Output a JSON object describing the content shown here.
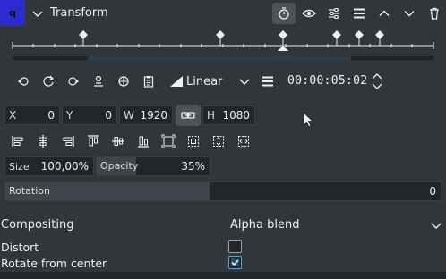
{
  "header": {
    "effect_badge": "q",
    "title": "Transform"
  },
  "interpolation": {
    "selected": "Linear"
  },
  "timecode": "00:00:05:02",
  "geometry": {
    "x_label": "X",
    "x_value": "0",
    "y_label": "Y",
    "y_value": "0",
    "w_label": "W",
    "w_value": "1920",
    "h_label": "H",
    "h_value": "1080"
  },
  "size": {
    "label": "Size",
    "value": "100,00%"
  },
  "opacity": {
    "label": "Opacity",
    "value": "35%"
  },
  "rotation": {
    "label": "Rotation",
    "value": "0"
  },
  "compositing": {
    "label": "Compositing",
    "value": "Alpha blend"
  },
  "distort": {
    "label": "Distort",
    "checked": false
  },
  "rotate_from_center": {
    "label": "Rotate from center",
    "checked": true
  },
  "colors": {
    "background": "#31363b",
    "field": "#232629",
    "accent": "#3daee9",
    "badge": "#2222cc"
  }
}
